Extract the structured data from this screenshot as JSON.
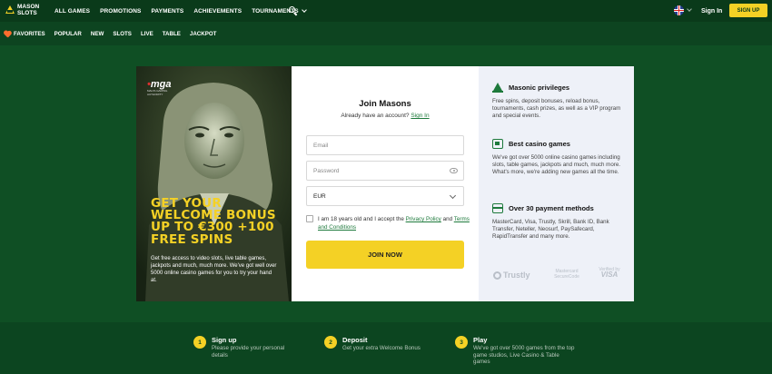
{
  "brand": {
    "logo_line1": "MASON",
    "logo_line2": "SLOTS"
  },
  "topnav": {
    "items": [
      "ALL GAMES",
      "PROMOTIONS",
      "PAYMENTS",
      "ACHIEVEMENTS"
    ],
    "tournaments": "TOURNAMENTS",
    "signin": "Sign In",
    "signup": "SIGN UP"
  },
  "subnav": {
    "favorites": "FAVORITES",
    "items": [
      "POPULAR",
      "NEW",
      "SLOTS",
      "LIVE",
      "TABLE",
      "JACKPOT"
    ]
  },
  "promo": {
    "mga_mark": "mga",
    "mga_sub": "MALTA GAMING AUTHORITY",
    "headline_lines": [
      "GET YOUR",
      "WELCOME BONUS",
      "UP TO €300 +100",
      "FREE SPINS"
    ],
    "description": "Get free access to video slots, live table games, jackpots and much, much more. We've got well over 5000 online casino games for you to try your hand at."
  },
  "form": {
    "title": "Join Masons",
    "sub_text": "Already have an account?",
    "sub_link": "Sign In",
    "email_placeholder": "Email",
    "password_placeholder": "Password",
    "currency": "EUR",
    "consent_1": "I am 18 years old and I accept the",
    "privacy": "Privacy Policy",
    "and": "and",
    "terms": "Terms and Conditions",
    "submit": "JOIN NOW"
  },
  "benefits": [
    {
      "icon": "pyramid-icon",
      "title": "Masonic privileges",
      "text": "Free spins, deposit bonuses, reload bonus, tournaments, cash prizes, as well as a VIP program and special events."
    },
    {
      "icon": "casino-games-icon",
      "title": "Best casino games",
      "text": "We've got over 5000 online casino games including slots, table games, jackpots and much, much more. What's more, we're adding new games all the time."
    },
    {
      "icon": "payment-card-icon",
      "title": "Over 30 payment methods",
      "text": "MasterCard, Visa, Trustly, Skrill, Bank ID, Bank Transfer, Neteller, Neosurf, PaySafecard, RapidTransfer and many more."
    }
  ],
  "payment_logos": {
    "trustly": "Trustly",
    "mastercard_1": "Mastercard",
    "mastercard_2": "SecureCode",
    "visa_1": "Verified by",
    "visa_2": "VISA"
  },
  "steps": [
    {
      "num": "1",
      "title": "Sign up",
      "desc": "Please provide your personal details"
    },
    {
      "num": "2",
      "title": "Deposit",
      "desc": "Get your extra Welcome Bonus"
    },
    {
      "num": "3",
      "title": "Play",
      "desc": "We've got over 5000 games from the top game studios, Live Casino & Table games"
    }
  ],
  "colors": {
    "accent": "#f4d125",
    "bg_dark": "#0a3a1a",
    "bg_main": "#0f4f24",
    "link": "#1e7a3c"
  }
}
